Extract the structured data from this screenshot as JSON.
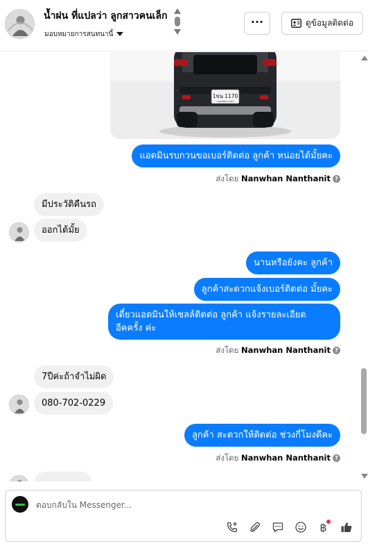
{
  "header": {
    "title": "น้ำฝน ที่แปลว่า ลูกสาวคนเล็ก",
    "assign_label": "มอบหมายการสนทนานี้",
    "more_label": "···",
    "contact_label": "ดูข้อมูลติดต่อ"
  },
  "messages": {
    "m1": "แอดมินรบกวนขอเบอร์ติดต่อ ลูกค้า หน่อยได้มั้ยคะ",
    "m2": "มีประวัติคืนรถ",
    "m3": "ออกได้มั้ย",
    "m4": "นานหรือยังคะ  ลูกค้า",
    "m5": "ลูกค้าสะดวกแจ้งเบอร์ติดต่อ มั้ยคะ",
    "m6_line1": "เดี๋ยวแอดมินให้เซลล์ติดต่อ ลูกค้า แจ้งรายละเอียด",
    "m6_line2": "อีคครั้ง ค่ะ",
    "m7": "7ปีค่ะถ้าจำไม่ผิด",
    "m8": "080-702-0229",
    "m9": "ลูกค้า สะดวกให้ติดต่อ ช่วงกี่โมงดีคะ"
  },
  "sent_by": {
    "prefix": "ส่งโดย",
    "name": "Nanwhan Nanthanit"
  },
  "car": {
    "plate_line1": "1ขน 1170",
    "plate_line2": "กรุงเทพมหานคร"
  },
  "composer": {
    "placeholder": "ตอบกลับใน Messenger..."
  },
  "icons": [
    "phone-plus-icon",
    "paperclip-icon",
    "saved-reply-icon",
    "emoji-icon",
    "baht-icon",
    "like-icon"
  ],
  "colors": {
    "outgoing": "#0a7cff",
    "incoming": "#f0f0f0"
  }
}
